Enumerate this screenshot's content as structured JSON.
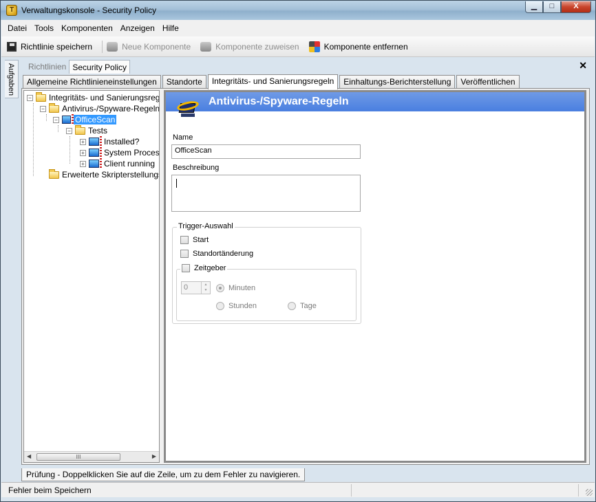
{
  "window": {
    "title": "Verwaltungskonsole - Security Policy",
    "controls": {
      "minimize": "▁",
      "maximize": "□",
      "close": "X"
    }
  },
  "menu": [
    "Datei",
    "Tools",
    "Komponenten",
    "Anzeigen",
    "Hilfe"
  ],
  "toolbar": {
    "save": "Richtlinie speichern",
    "new_component": "Neue Komponente",
    "assign_component": "Komponente zuweisen",
    "remove_component": "Komponente entfernen"
  },
  "side_panel": {
    "label": "Aufgaben"
  },
  "doc_tabs": [
    "Richtlinien",
    "Security Policy"
  ],
  "tabs": [
    "Allgemeine Richtlinieneinstellungen",
    "Standorte",
    "Integritäts- und Sanierungsregeln",
    "Einhaltungs-Berichterstellung",
    "Veröffentlichen"
  ],
  "tree": {
    "root": "Integritäts- und Sanierungsreg",
    "antivirus": "Antivirus-/Spyware-Regeln",
    "officescan": "OfficeScan",
    "tests": "Tests",
    "test_items": [
      "Installed?",
      "System Proces",
      "Client running"
    ],
    "advanced": "Erweiterte Skripterstellungs",
    "scroll_thumb": "III"
  },
  "detail": {
    "header": "Antivirus-/Spyware-Regeln",
    "name_label": "Name",
    "name_value": "OfficeScan",
    "description_label": "Beschreibung",
    "trigger_group": "Trigger-Auswahl",
    "triggers": [
      "Start",
      "Standortänderung"
    ],
    "timer_label": "Zeitgeber",
    "timer_value": "0",
    "units": {
      "minutes": "Minuten",
      "hours": "Stunden",
      "days": "Tage"
    }
  },
  "messages_tab": "Prüfung - Doppelklicken Sie auf die Zeile, um zu dem Fehler zu navigieren.",
  "status": {
    "text": "Fehler beim Speichern"
  }
}
